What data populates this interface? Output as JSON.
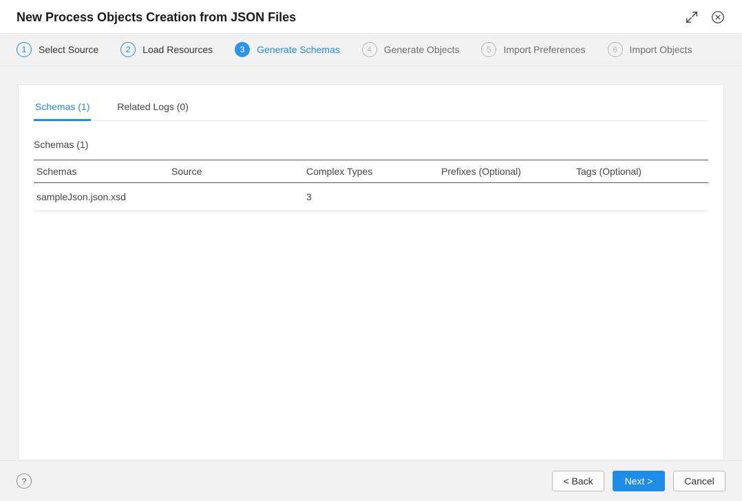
{
  "header": {
    "title": "New Process Objects Creation from JSON Files"
  },
  "stepper": {
    "steps": [
      {
        "num": "1",
        "label": "Select Source",
        "state": "done"
      },
      {
        "num": "2",
        "label": "Load Resources",
        "state": "done"
      },
      {
        "num": "3",
        "label": "Generate Schemas",
        "state": "current"
      },
      {
        "num": "4",
        "label": "Generate Objects",
        "state": "future"
      },
      {
        "num": "5",
        "label": "Import Preferences",
        "state": "future"
      },
      {
        "num": "6",
        "label": "Import Objects",
        "state": "future"
      }
    ]
  },
  "tabs": {
    "schemas": "Schemas (1)",
    "related_logs": "Related Logs (0)"
  },
  "section": {
    "title": "Schemas (1)"
  },
  "table": {
    "headers": {
      "schemas": "Schemas",
      "source": "Source",
      "complex_types": "Complex Types",
      "prefixes": "Prefixes (Optional)",
      "tags": "Tags (Optional)"
    },
    "rows": [
      {
        "schemas": "sampleJson.json.xsd",
        "source": "",
        "complex_types": "3",
        "prefixes": "",
        "tags": ""
      }
    ]
  },
  "footer": {
    "help": "?",
    "back": "< Back",
    "next": "Next >",
    "cancel": "Cancel"
  }
}
